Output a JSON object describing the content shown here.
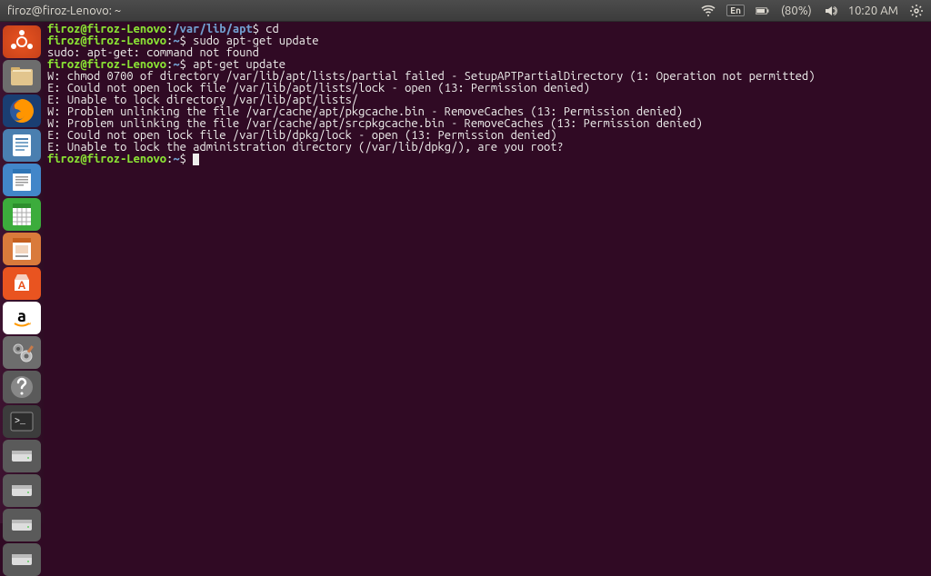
{
  "menubar": {
    "title": "firoz@firoz-Lenovo: ~",
    "indicators": {
      "lang": "En",
      "battery": "(80%)",
      "time": "10:20 AM"
    }
  },
  "launcher": {
    "items": [
      {
        "name": "dash-icon"
      },
      {
        "name": "files-icon"
      },
      {
        "name": "firefox-icon"
      },
      {
        "name": "document-icon"
      },
      {
        "name": "writer-icon"
      },
      {
        "name": "calc-icon"
      },
      {
        "name": "impress-icon"
      },
      {
        "name": "software-icon"
      },
      {
        "name": "amazon-icon"
      },
      {
        "name": "settings-icon"
      },
      {
        "name": "anjuta-icon"
      },
      {
        "name": "terminal-icon"
      },
      {
        "name": "drive1-icon"
      },
      {
        "name": "drive2-icon"
      },
      {
        "name": "drive3-icon"
      },
      {
        "name": "drive4-icon"
      }
    ]
  },
  "terminal": {
    "lines": [
      {
        "type": "prompt",
        "user": "firoz@firoz-Lenovo",
        "sep": ":",
        "path": "/var/lib/apt",
        "sym": "$ ",
        "cmd": "cd"
      },
      {
        "type": "prompt",
        "user": "firoz@firoz-Lenovo",
        "sep": ":",
        "path": "~",
        "sym": "$ ",
        "cmd": "sudo apt-get update"
      },
      {
        "type": "out",
        "text": "sudo: apt-get: command not found"
      },
      {
        "type": "prompt",
        "user": "firoz@firoz-Lenovo",
        "sep": ":",
        "path": "~",
        "sym": "$ ",
        "cmd": "apt-get update"
      },
      {
        "type": "out",
        "text": "W: chmod 0700 of directory /var/lib/apt/lists/partial failed - SetupAPTPartialDirectory (1: Operation not permitted)"
      },
      {
        "type": "out",
        "text": "E: Could not open lock file /var/lib/apt/lists/lock - open (13: Permission denied)"
      },
      {
        "type": "out",
        "text": "E: Unable to lock directory /var/lib/apt/lists/"
      },
      {
        "type": "out",
        "text": "W: Problem unlinking the file /var/cache/apt/pkgcache.bin - RemoveCaches (13: Permission denied)"
      },
      {
        "type": "out",
        "text": "W: Problem unlinking the file /var/cache/apt/srcpkgcache.bin - RemoveCaches (13: Permission denied)"
      },
      {
        "type": "out",
        "text": "E: Could not open lock file /var/lib/dpkg/lock - open (13: Permission denied)"
      },
      {
        "type": "out",
        "text": "E: Unable to lock the administration directory (/var/lib/dpkg/), are you root?"
      },
      {
        "type": "prompt",
        "user": "firoz@firoz-Lenovo",
        "sep": ":",
        "path": "~",
        "sym": "$ ",
        "cmd": "",
        "cursor": true
      }
    ]
  }
}
